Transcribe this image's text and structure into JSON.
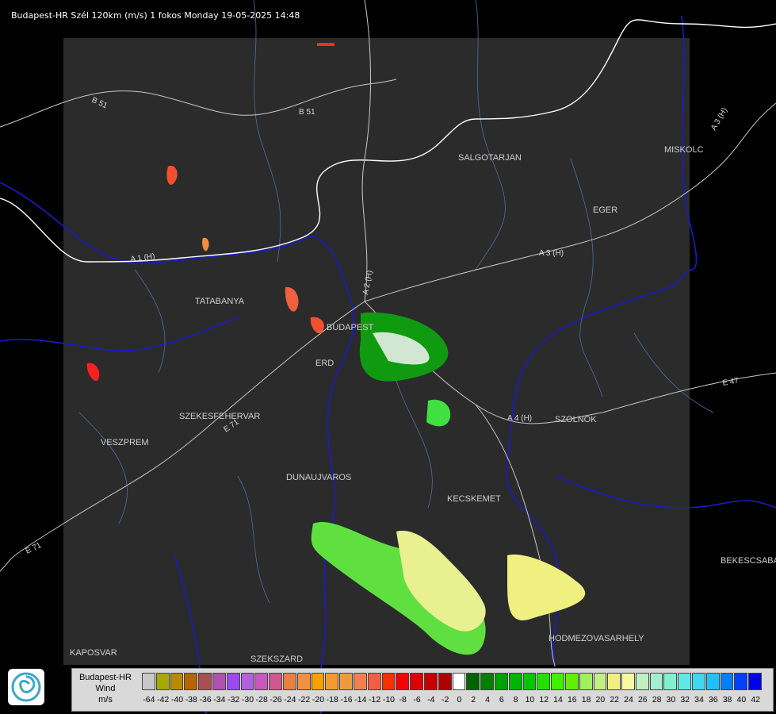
{
  "header": {
    "title": "Budapest-HR Szél 120km (m/s) 1 fokos Monday 19-05-2025 14:48"
  },
  "map": {
    "background_color": "#000000",
    "radar_area_color": "#2b2b2b",
    "cities": [
      "SALGOTARJAN",
      "MISKOLC",
      "EGER",
      "TATABANYA",
      "BUDAPEST",
      "ERD",
      "SZEKESFEHERVAR",
      "VESZPREM",
      "DUNAUJVAROS",
      "KECSKEMET",
      "SZOLNOK",
      "BEKESCSABA",
      "HODMEZOVASARHELY",
      "KAPOSVAR",
      "SZEKSZARD"
    ],
    "roads": [
      "B 51",
      "B 51",
      "A 3 (H)",
      "A 3 (H)",
      "A 1 (H)",
      "A 2 (H)",
      "A 4 (H)",
      "E 71",
      "E 71",
      "E 47"
    ]
  },
  "logo": {
    "icon": "omsz-swirl-logo-icon"
  },
  "legend": {
    "title_lines": [
      "Budapest-HR",
      "Wind",
      "m/s"
    ],
    "colors": [
      "#c8c8c8",
      "#a8a800",
      "#b88a00",
      "#b86400",
      "#a85050",
      "#b050b0",
      "#9a4aee",
      "#b45ee0",
      "#c858c0",
      "#d05890",
      "#e88040",
      "#f09040",
      "#f8a000",
      "#f09a30",
      "#f09a40",
      "#f08050",
      "#f06040",
      "#f83000",
      "#f80000",
      "#e00000",
      "#c80000",
      "#b00000",
      "#ffffff",
      "#006400",
      "#008000",
      "#00a000",
      "#00b400",
      "#00c800",
      "#20e000",
      "#40f000",
      "#60f000",
      "#a0f060",
      "#c0f080",
      "#f0f080",
      "#f8f8a0",
      "#c0f0c0",
      "#a0f0d0",
      "#80f0d0",
      "#60e8e8",
      "#40d8f0",
      "#20c0f8",
      "#0080f8",
      "#0040f8",
      "#0000f0"
    ],
    "ticks": [
      "-64",
      "-42",
      "-40",
      "-38",
      "-36",
      "-34",
      "-32",
      "-30",
      "-28",
      "-26",
      "-24",
      "-22",
      "-20",
      "-18",
      "-16",
      "-14",
      "-12",
      "-10",
      "-8",
      "-6",
      "-4",
      "-2",
      "0",
      "2",
      "4",
      "6",
      "8",
      "10",
      "12",
      "14",
      "16",
      "18",
      "20",
      "22",
      "24",
      "26",
      "28",
      "30",
      "32",
      "34",
      "36",
      "38",
      "40",
      "42"
    ]
  }
}
